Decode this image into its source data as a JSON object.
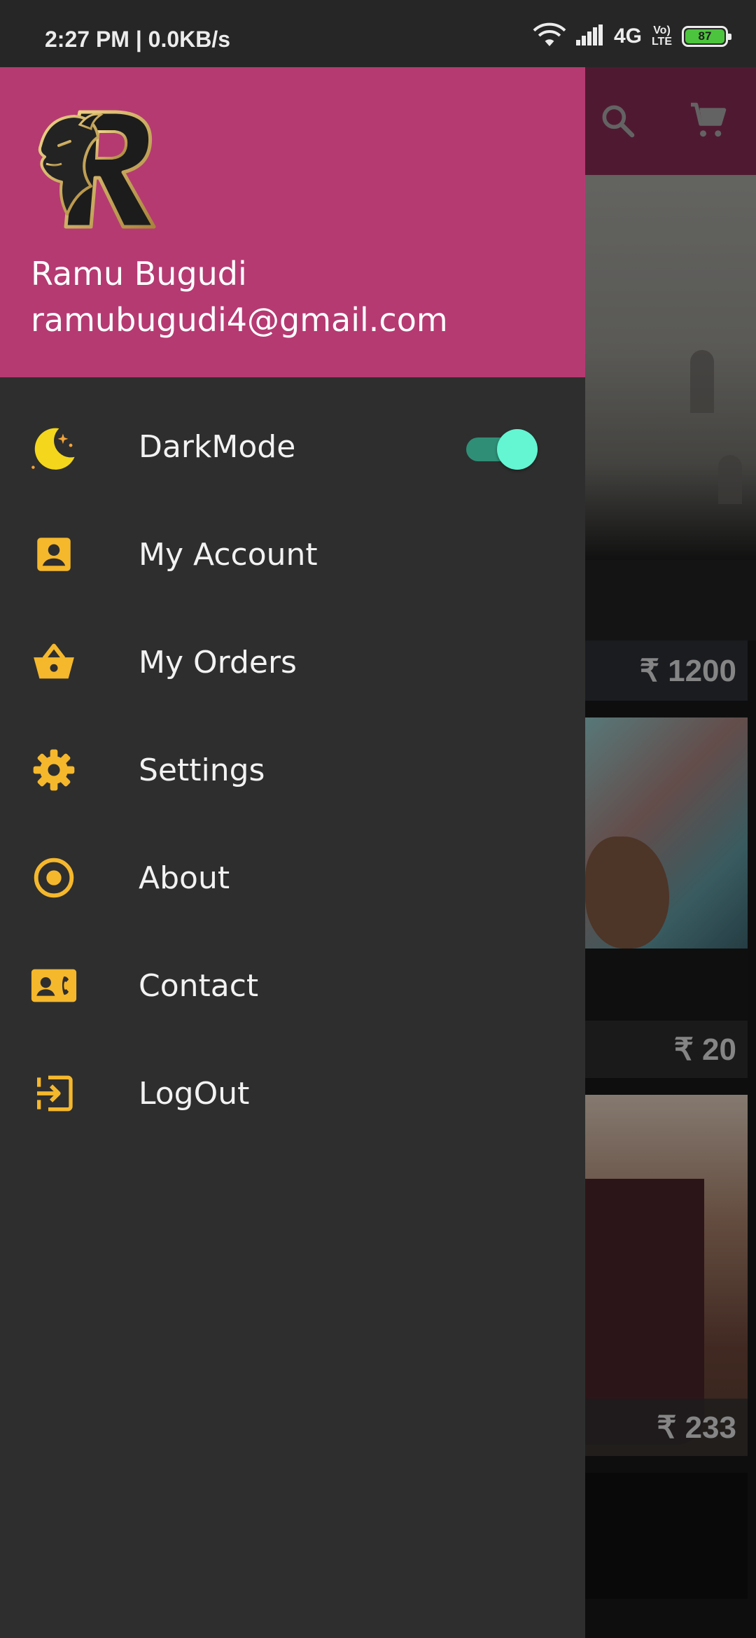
{
  "status_bar": {
    "time": "2:27 PM | 0.0KB/s",
    "network": "4G",
    "volte_top": "Vo)",
    "volte_bottom": "LTE",
    "battery": "87"
  },
  "drawer": {
    "user_name": "Ramu Bugudi",
    "user_email": "ramubugudi4@gmail.com",
    "items": [
      {
        "label": "DarkMode",
        "icon": "moon-icon",
        "toggle_on": true
      },
      {
        "label": "My Account",
        "icon": "account-box-icon"
      },
      {
        "label": "My Orders",
        "icon": "basket-icon"
      },
      {
        "label": "Settings",
        "icon": "gear-icon"
      },
      {
        "label": "About",
        "icon": "circle-dot-icon"
      },
      {
        "label": "Contact",
        "icon": "contact-card-icon"
      },
      {
        "label": "LogOut",
        "icon": "logout-icon"
      }
    ]
  },
  "background": {
    "products": [
      {
        "price": "₹ 1200"
      },
      {
        "price": "₹ 20"
      },
      {
        "price": "₹ 233"
      }
    ]
  },
  "colors": {
    "header": "#b53a72",
    "drawer": "#2e2e2e",
    "icon_accent": "#f5b82c",
    "toggle_thumb": "#64f5d2"
  }
}
